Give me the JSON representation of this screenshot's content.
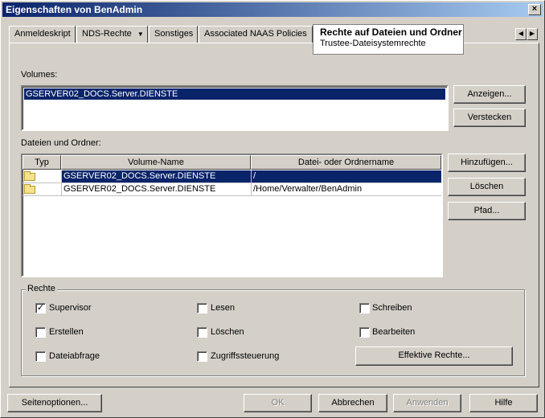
{
  "window": {
    "title": "Eigenschaften von BenAdmin",
    "close_glyph": "×"
  },
  "tabs": [
    {
      "label": "Anmeldeskript"
    },
    {
      "label": "NDS-Rechte",
      "dropdown_glyph": "▼"
    },
    {
      "label": "Sonstiges"
    },
    {
      "label": "Associated NAAS Policies"
    }
  ],
  "active_tab": {
    "label": "Rechte auf Dateien und Ordner",
    "sublabel": "Trustee-Dateisystemrechte"
  },
  "tab_scroll": {
    "left_glyph": "◀",
    "right_glyph": "▶"
  },
  "volumes": {
    "label": "Volumes:",
    "items": [
      "GSERVER02_DOCS.Server.DIENSTE"
    ],
    "show_button": "Anzeigen...",
    "hide_button": "Verstecken"
  },
  "files": {
    "label": "Dateien und Ordner:",
    "columns": [
      "Typ",
      "Volume-Name",
      "Datei- oder Ordnername"
    ],
    "rows": [
      {
        "volume": "GSERVER02_DOCS.Server.DIENSTE",
        "path": "/",
        "selected": true
      },
      {
        "volume": "GSERVER02_DOCS.Server.DIENSTE",
        "path": "/Home/Verwalter/BenAdmin",
        "selected": false
      }
    ],
    "add_button": "Hinzufügen...",
    "delete_button": "Löschen",
    "path_button": "Pfad..."
  },
  "rights": {
    "title": "Rechte",
    "checkboxes": [
      {
        "label": "Supervisor",
        "checked": true
      },
      {
        "label": "Lesen",
        "checked": false
      },
      {
        "label": "Schreiben",
        "checked": false
      },
      {
        "label": "Erstellen",
        "checked": false
      },
      {
        "label": "Löschen",
        "checked": false
      },
      {
        "label": "Bearbeiten",
        "checked": false
      },
      {
        "label": "Dateiabfrage",
        "checked": false
      },
      {
        "label": "Zugriffssteuerung",
        "checked": false
      }
    ],
    "effective_button": "Effektive Rechte..."
  },
  "footer": {
    "page_options": "Seitenoptionen...",
    "ok": "OK",
    "cancel": "Abbrechen",
    "apply": "Anwenden",
    "help": "Hilfe"
  },
  "check_glyph": "✓"
}
